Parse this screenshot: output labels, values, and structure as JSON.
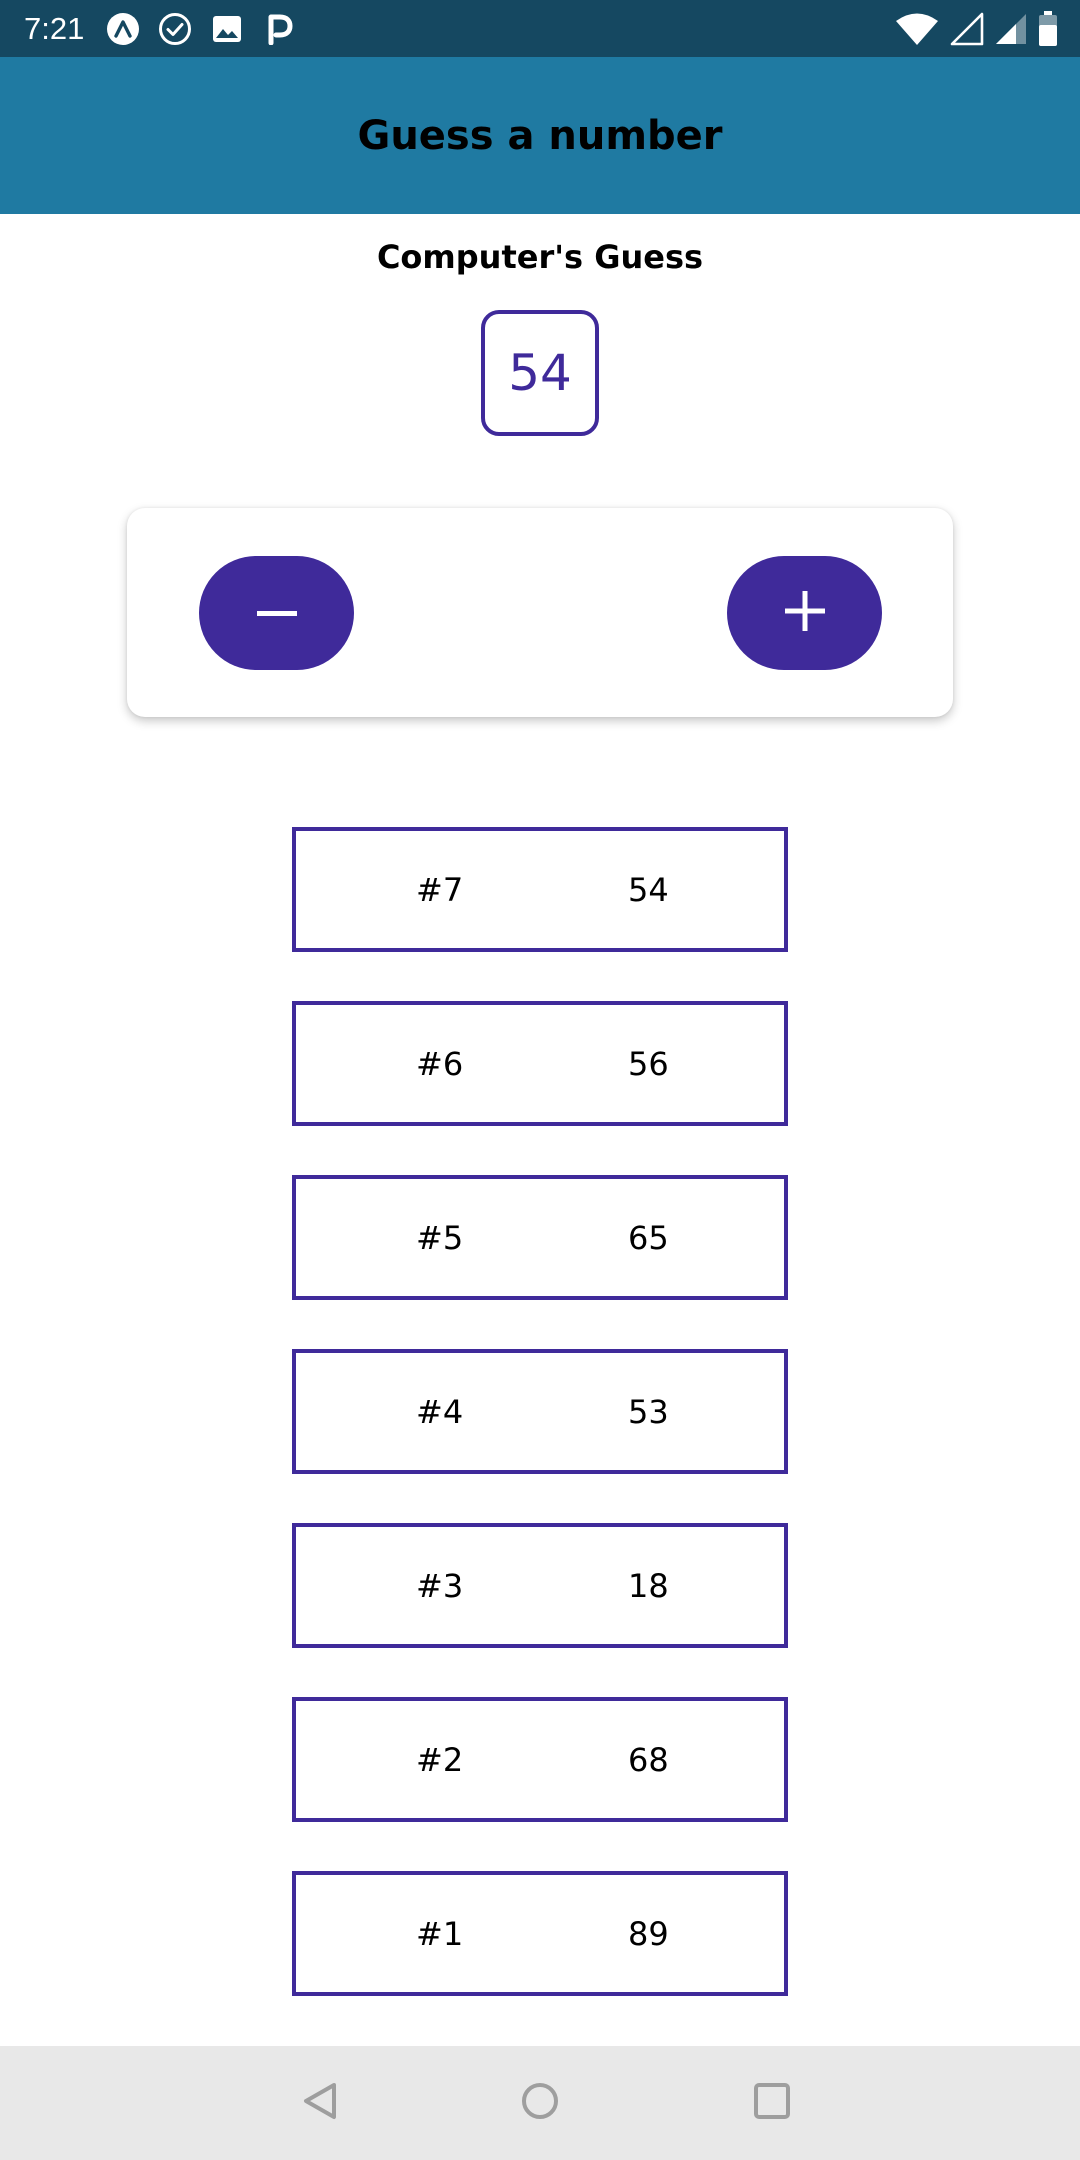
{
  "status_bar": {
    "time": "7:21",
    "notification_icons": [
      "expo-icon",
      "check-circle-icon",
      "image-icon",
      "parking-icon"
    ],
    "system_icons": [
      "wifi-icon",
      "signal-icon",
      "signal-icon",
      "battery-icon"
    ]
  },
  "header": {
    "title": "Guess a number"
  },
  "main": {
    "guess_label": "Computer's Guess",
    "current_guess": "54",
    "controls": {
      "lower_label": "−",
      "higher_label": "+"
    },
    "guesses": [
      {
        "round": "#7",
        "value": "54"
      },
      {
        "round": "#6",
        "value": "56"
      },
      {
        "round": "#5",
        "value": "65"
      },
      {
        "round": "#4",
        "value": "53"
      },
      {
        "round": "#3",
        "value": "18"
      },
      {
        "round": "#2",
        "value": "68"
      },
      {
        "round": "#1",
        "value": "89"
      }
    ]
  },
  "nav_bar": {
    "icons": [
      "back-icon",
      "home-icon",
      "recents-icon"
    ]
  },
  "colors": {
    "status_bar": "#154861",
    "header": "#1f7aa2",
    "accent": "#3f2a9a",
    "nav_bar": "#e8e8e8"
  }
}
